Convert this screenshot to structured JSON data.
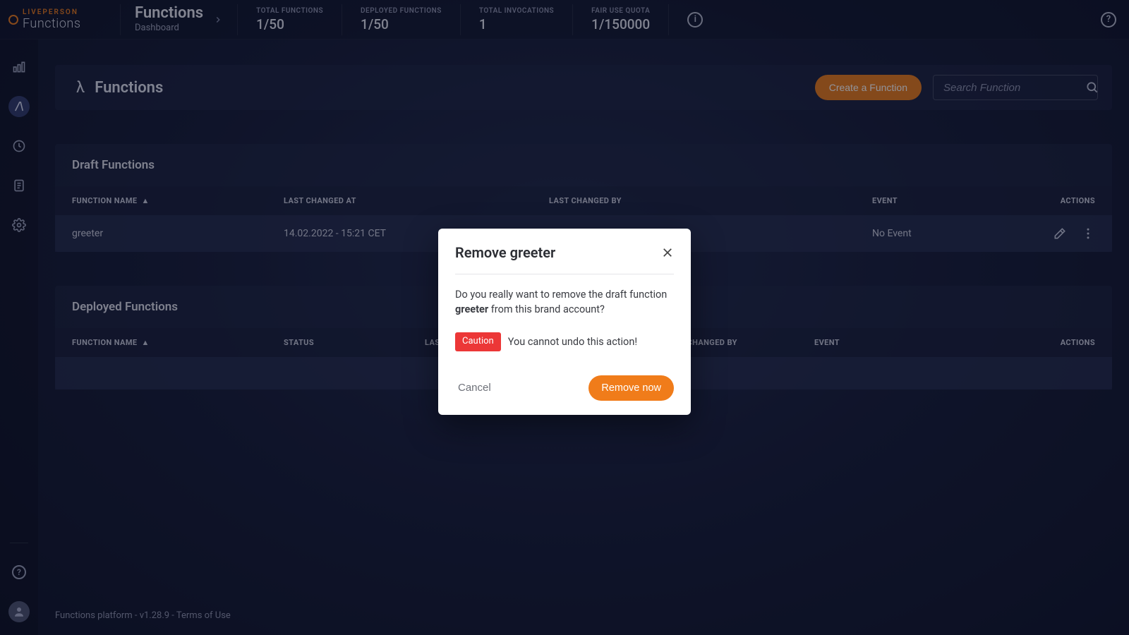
{
  "brand": {
    "line1": "LIVEPERSON",
    "line2": "Functions"
  },
  "breadcrumb": {
    "title": "Functions",
    "subtitle": "Dashboard"
  },
  "stats": {
    "total_functions": {
      "label": "TOTAL FUNCTIONS",
      "value": "1/50"
    },
    "deployed_functions": {
      "label": "DEPLOYED FUNCTIONS",
      "value": "1/50"
    },
    "total_invocations": {
      "label": "TOTAL INVOCATIONS",
      "value": "1"
    },
    "fair_use_quota": {
      "label": "FAIR USE QUOTA",
      "value": "1/150000"
    }
  },
  "page": {
    "title": "Functions",
    "create_label": "Create a Function",
    "search_placeholder": "Search Function"
  },
  "draft": {
    "title": "Draft Functions",
    "columns": {
      "name": "FUNCTION NAME",
      "changed_at": "LAST CHANGED AT",
      "changed_by": "LAST CHANGED BY",
      "event": "EVENT",
      "actions": "ACTIONS"
    },
    "rows": [
      {
        "name": "greeter",
        "changed_at": "14.02.2022 - 15:21 CET",
        "changed_by": "",
        "event": "No Event"
      }
    ]
  },
  "deployed": {
    "title": "Deployed Functions",
    "columns": {
      "name": "FUNCTION NAME",
      "status": "STATUS",
      "changed_at": "LAST CHANGED AT",
      "changed_by": "LAST CHANGED BY",
      "event": "EVENT",
      "actions": "ACTIONS"
    }
  },
  "footer": "Functions platform - v1.28.9 - Terms of Use",
  "modal": {
    "title": "Remove greeter",
    "body_prefix": "Do you really want to remove the draft function ",
    "body_strong": "greeter",
    "body_suffix": " from this brand account?",
    "caution_badge": "Caution",
    "caution_text": "You cannot undo this action!",
    "cancel": "Cancel",
    "confirm": "Remove now"
  }
}
